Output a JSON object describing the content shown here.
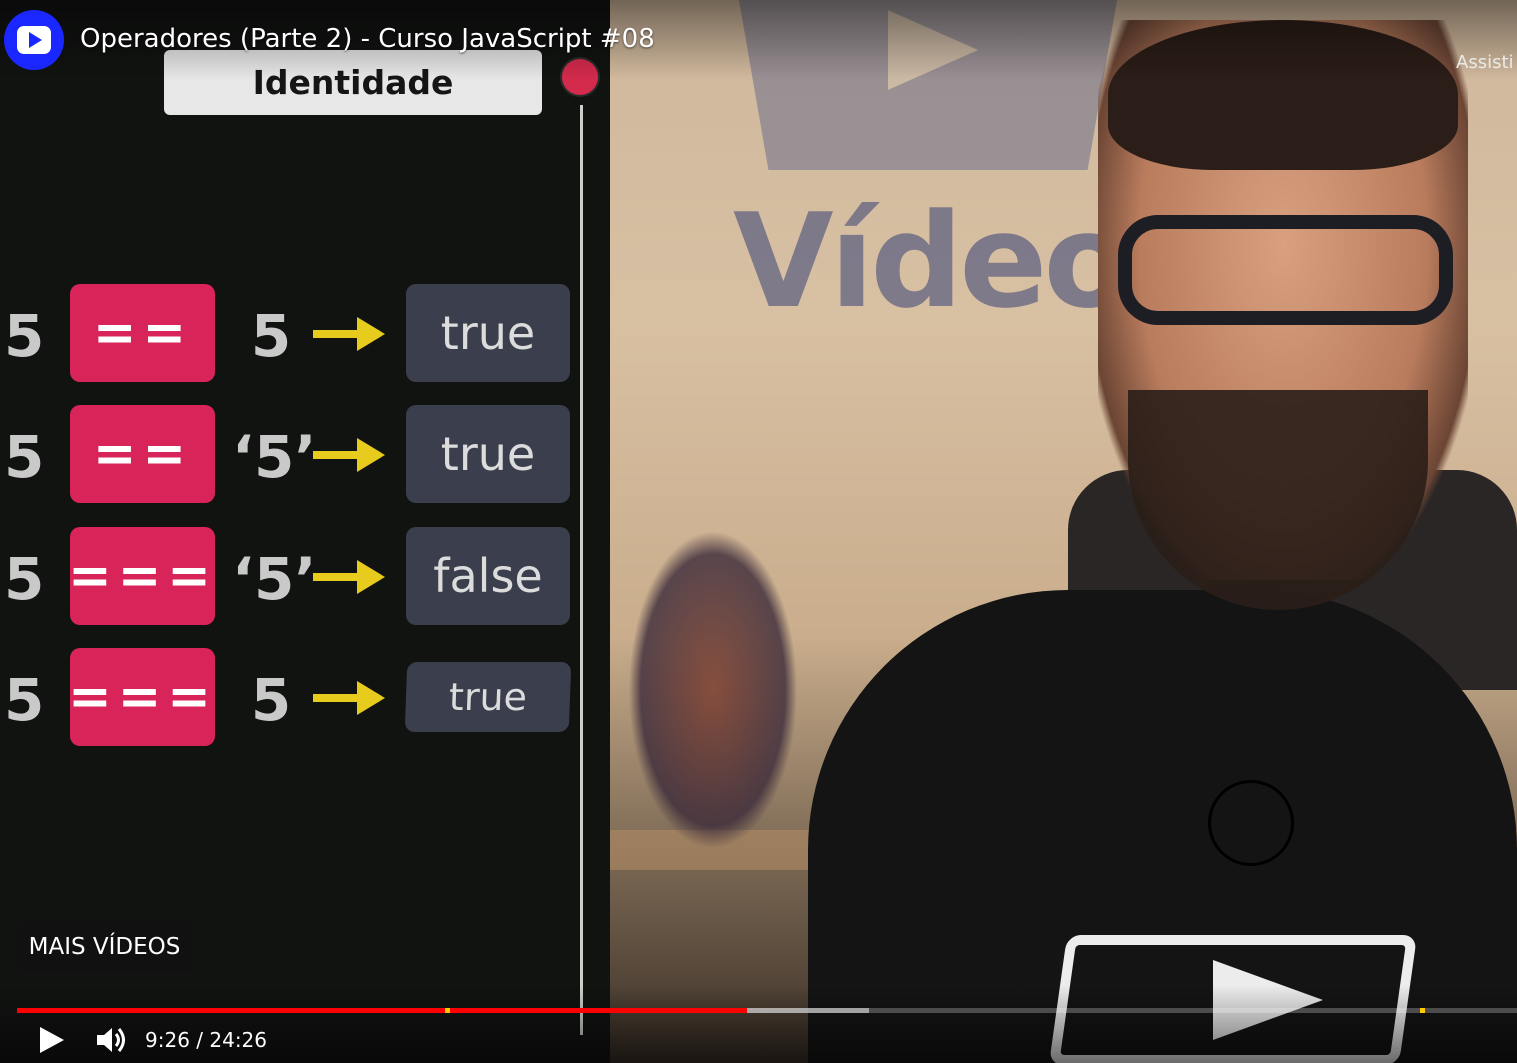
{
  "video": {
    "title": "Operadores (Parte 2) - Curso JavaScript #08",
    "watch_later_label": "Assisti",
    "more_videos_label": "MAIS VÍDEOS",
    "time": "9:26 / 24:26",
    "progress_played_fraction": 0.4866,
    "progress_buffer_fraction": 0.5683,
    "chapter_markers_fraction": [
      0.2853,
      0.9353
    ]
  },
  "slide": {
    "title": "Identidade",
    "rows": [
      {
        "lhs": "5",
        "operator": "==",
        "rhs": "5",
        "result": "true"
      },
      {
        "lhs": "5",
        "operator": "==",
        "rhs": "‘5’",
        "result": "true"
      },
      {
        "lhs": "5",
        "operator": "===",
        "rhs": "‘5’",
        "result": "false"
      },
      {
        "lhs": "5",
        "operator": "===",
        "rhs": "5",
        "result": "true"
      }
    ]
  },
  "background": {
    "wall_text": "Vídeo"
  },
  "icons": {
    "channel": "channel-logo-icon",
    "play": "play-icon",
    "volume": "volume-icon",
    "arrow": "arrow-right-icon"
  },
  "colors": {
    "operator_bg": "#d9245a",
    "result_bg": "#3b3f4d",
    "arrow": "#e7cb1d",
    "progress_played": "#ff0000",
    "channel_logo": "#1a27ff"
  }
}
